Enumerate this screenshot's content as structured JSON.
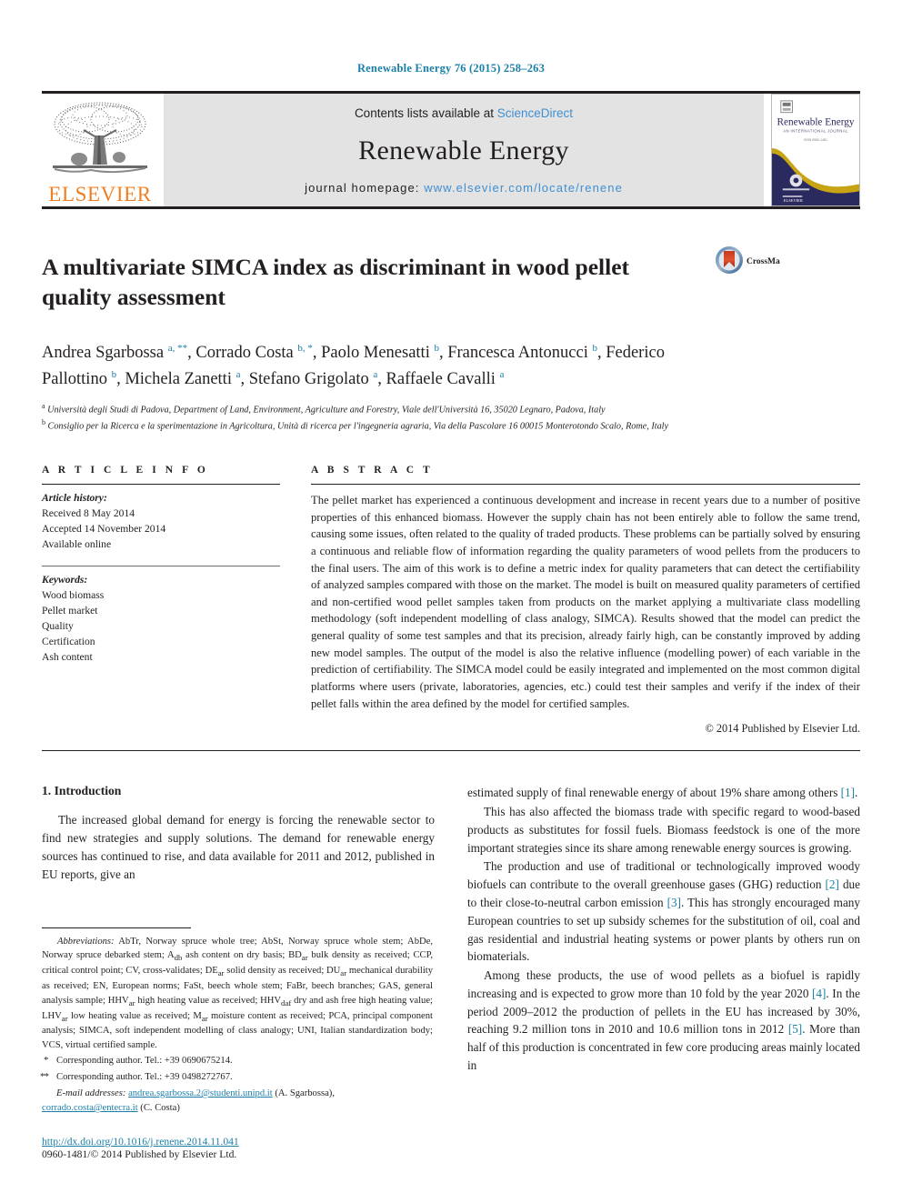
{
  "running_head": "Renewable Energy 76 (2015) 258–263",
  "masthead": {
    "publisher_name": "ELSEVIER",
    "contents_prefix": "Contents lists available at ",
    "contents_link": "ScienceDirect",
    "journal_name": "Renewable Energy",
    "homepage_prefix": "journal homepage: ",
    "homepage_url": "www.elsevier.com/locate/renene",
    "cover": {
      "title": "Renewable Energy",
      "subtitle": "AN INTERNATIONAL JOURNAL",
      "tagline": "ISSN 0960-1481",
      "publisher": "ELSEVIER"
    }
  },
  "article": {
    "title": "A multivariate SIMCA index as discriminant in wood pellet quality assessment",
    "crossmark_label": "CrossMark",
    "authors_html": "Andrea Sgarbossa <sup>a, **</sup>, Corrado Costa <sup>b, *</sup>, Paolo Menesatti <sup>b</sup>, Francesca Antonucci <sup>b</sup>, Federico Pallottino <sup>b</sup>, Michela Zanetti <sup>a</sup>, Stefano Grigolato <sup>a</sup>, Raffaele Cavalli <sup>a</sup>",
    "affiliations": [
      "<sup>a</sup> Università degli Studi di Padova, Department of Land, Environment, Agriculture and Forestry, Viale dell'Università 16, 35020 Legnaro, Padova, Italy",
      "<sup>b</sup> Consiglio per la Ricerca e la sperimentazione in Agricoltura, Unità di ricerca per l'ingegneria agraria, Via della Pascolare 16 00015 Monterotondo Scalo, Rome, Italy"
    ]
  },
  "article_info": {
    "heading": "A R T I C L E   I N F O",
    "history_label": "Article history:",
    "history": [
      "Received 8 May 2014",
      "Accepted 14 November 2014",
      "Available online"
    ],
    "keywords_label": "Keywords:",
    "keywords": [
      "Wood biomass",
      "Pellet market",
      "Quality",
      "Certification",
      "Ash content"
    ]
  },
  "abstract": {
    "heading": "A B S T R A C T",
    "text": "The pellet market has experienced a continuous development and increase in recent years due to a number of positive properties of this enhanced biomass. However the supply chain has not been entirely able to follow the same trend, causing some issues, often related to the quality of traded products. These problems can be partially solved by ensuring a continuous and reliable flow of information regarding the quality parameters of wood pellets from the producers to the final users. The aim of this work is to define a metric index for quality parameters that can detect the certifiability of analyzed samples compared with those on the market. The model is built on measured quality parameters of certified and non-certified wood pellet samples taken from products on the market applying a multivariate class modelling methodology (soft independent modelling of class analogy, SIMCA). Results showed that the model can predict the general quality of some test samples and that its precision, already fairly high, can be constantly improved by adding new model samples. The output of the model is also the relative influence (modelling power) of each variable in the prediction of certifiability. The SIMCA model could be easily integrated and implemented on the most common digital platforms where users (private, laboratories, agencies, etc.) could test their samples and verify if the index of their pellet falls within the area defined by the model for certified samples.",
    "copyright": "© 2014 Published by Elsevier Ltd."
  },
  "introduction": {
    "heading": "1.  Introduction",
    "left_paragraphs": [
      "The increased global demand for energy is forcing the renewable sector to find new strategies and supply solutions. The demand for renewable energy sources has continued to rise, and data available for 2011 and 2012, published in EU reports, give an"
    ],
    "right_paragraphs": [
      {
        "indent": false,
        "html": "estimated supply of final renewable energy of about 19% share among others <span class=\"ref\">[1]</span>."
      },
      {
        "indent": true,
        "html": "This has also affected the biomass trade with specific regard to wood-based products as substitutes for fossil fuels. Biomass feedstock is one of the more important strategies since its share among renewable energy sources is growing."
      },
      {
        "indent": true,
        "html": "The production and use of traditional or technologically improved woody biofuels can contribute to the overall greenhouse gases (GHG) reduction <span class=\"ref\">[2]</span> due to their close-to-neutral carbon emission <span class=\"ref\">[3]</span>. This has strongly encouraged many European countries to set up subsidy schemes for the substitution of oil, coal and gas residential and industrial heating systems or power plants by others run on biomaterials."
      },
      {
        "indent": true,
        "html": "Among these products, the use of wood pellets as a biofuel is rapidly increasing and is expected to grow more than 10 fold by the year 2020 <span class=\"ref\">[4]</span>. In the period 2009–2012 the production of pellets in the EU has increased by 30%, reaching 9.2 million tons in 2010 and 10.6 million tons in 2012 <span class=\"ref\">[5]</span>. More than half of this production is concentrated in few core producing areas mainly located in"
      }
    ]
  },
  "footnotes": {
    "abbreviations_label": "Abbreviations:",
    "abbreviations_html": "AbTr, Norway spruce whole tree; AbSt, Norway spruce whole stem; AbDe, Norway spruce debarked stem; A<sub>db</sub> ash content on dry basis; BD<sub>ar</sub> bulk density as received; CCP, critical control point; CV, cross-validates; DE<sub>ar</sub> solid density as received; DU<sub>ar</sub> mechanical durability as received; EN, European norms; FaSt, beech whole stem; FaBr, beech branches; GAS, general analysis sample; HHV<sub>ar</sub> high heating value as received; HHV<sub>daf</sub> dry and ash free high heating value; LHV<sub>ar</sub> low heating value as received; M<sub>ar</sub> moisture content as received; PCA, principal component analysis; SIMCA, soft independent modelling of class analogy; UNI, Italian standardization body; VCS, virtual certified sample.",
    "corresponding_1": "Corresponding author. Tel.: +39 0690675214.",
    "corresponding_2": "Corresponding author. Tel.: +39 0498272767.",
    "email_label": "E-mail addresses:",
    "email_1": "andrea.sgarbossa.2@studenti.unipd.it",
    "email_1_name": "(A. Sgarbossa)",
    "email_2": "corrado.costa@entecra.it",
    "email_2_name": "(C. Costa)",
    "doi": "http://dx.doi.org/10.1016/j.renene.2014.11.041",
    "issn": "0960-1481/© 2014 Published by Elsevier Ltd."
  },
  "colors": {
    "link": "#1a7fa8",
    "sciencedirect": "#3f8fd2",
    "elsevier_orange": "#f07f23",
    "band_gray": "#e3e3e3",
    "cover_navy": "#2b2a5e"
  }
}
